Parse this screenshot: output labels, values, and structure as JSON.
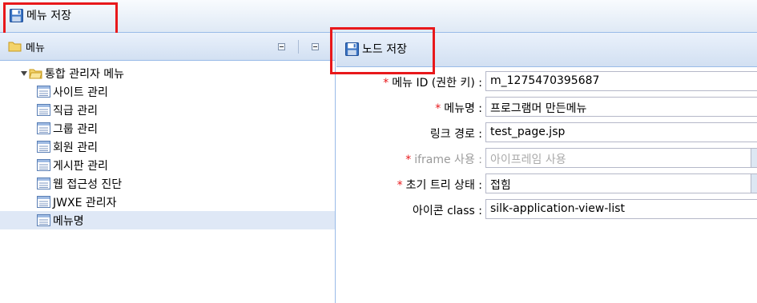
{
  "toolbar": {
    "save_menu_label": "메뉴 저장"
  },
  "left_panel": {
    "title": "메뉴",
    "tree": {
      "root_label": "통합 관리자 메뉴",
      "children": [
        "사이트 관리",
        "직급 관리",
        "그룹 관리",
        "회원 관리",
        "게시판 관리",
        "웹 접근성 진단",
        "JWXE 관리자",
        "메뉴명"
      ],
      "selected_index": 7
    }
  },
  "right_panel": {
    "save_node_label": "노드 저장",
    "fields": [
      {
        "required": true,
        "label": "메뉴 ID (권한 키) :",
        "value": "m_1275470395687",
        "disabled": false
      },
      {
        "required": true,
        "label": "메뉴명 :",
        "value": "프로그램머 만든메뉴",
        "disabled": false
      },
      {
        "required": false,
        "label": "링크 경로 :",
        "value": "test_page.jsp",
        "disabled": false
      },
      {
        "required": true,
        "label": "iframe 사용 :",
        "value": "아이프레임 사용",
        "disabled": true
      },
      {
        "required": true,
        "label": "초기 트리 상태 :",
        "value": "접힘",
        "disabled": false
      },
      {
        "required": false,
        "label": "아이콘 class :",
        "value": "silk-application-view-list",
        "disabled": false
      }
    ],
    "required_mark": "*"
  },
  "colors": {
    "highlight_box": "#e8181b",
    "panel_border": "#99bbe8",
    "selected_row": "#dfe8f6"
  }
}
